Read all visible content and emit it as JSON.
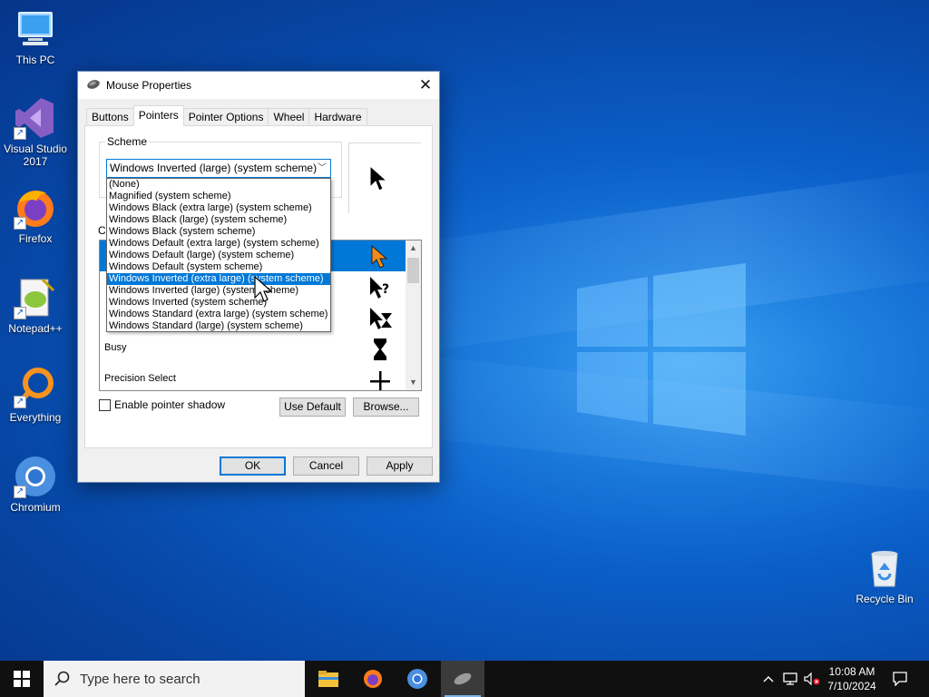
{
  "desktop": {
    "icons": [
      {
        "label": "This PC"
      },
      {
        "label": "Visual Studio 2017"
      },
      {
        "label": "Firefox"
      },
      {
        "label": "Notepad++"
      },
      {
        "label": "Everything"
      },
      {
        "label": "Chromium"
      },
      {
        "label": "Recycle Bin"
      }
    ]
  },
  "dialog": {
    "title": "Mouse Properties",
    "close_glyph": "✕",
    "tabs": [
      {
        "label": "Buttons"
      },
      {
        "label": "Pointers"
      },
      {
        "label": "Pointer Options"
      },
      {
        "label": "Wheel"
      },
      {
        "label": "Hardware"
      }
    ],
    "active_tab": "Pointers",
    "scheme": {
      "legend": "Scheme",
      "selected": "Windows Inverted (large) (system scheme)",
      "options": [
        "(None)",
        "Magnified (system scheme)",
        "Windows Black (extra large) (system scheme)",
        "Windows Black (large) (system scheme)",
        "Windows Black (system scheme)",
        "Windows Default (extra large) (system scheme)",
        "Windows Default (large) (system scheme)",
        "Windows Default (system scheme)",
        "Windows Inverted (extra large) (system scheme)",
        "Windows Inverted (large) (system scheme)",
        "Windows Inverted (system scheme)",
        "Windows Standard (extra large) (system scheme)",
        "Windows Standard (large) (system scheme)"
      ],
      "highlighted_option": "Windows Inverted (extra large) (system scheme)"
    },
    "customize_label": "C",
    "pointer_list": [
      {
        "label": "",
        "icon": "arrow-orange-icon"
      },
      {
        "label": "",
        "icon": "help-select-icon"
      },
      {
        "label": "",
        "icon": "working-in-background-icon"
      },
      {
        "label": "Busy",
        "icon": "hourglass-icon"
      },
      {
        "label": "Precision Select",
        "icon": "crosshair-icon"
      }
    ],
    "scroll_up": "▲",
    "scroll_down": "▼",
    "enable_shadow_label": "Enable pointer shadow",
    "use_default_label": "Use Default",
    "browse_label": "Browse...",
    "ok_label": "OK",
    "cancel_label": "Cancel",
    "apply_label": "Apply"
  },
  "taskbar": {
    "search_placeholder": "Type here to search",
    "time": "10:08 AM",
    "date": "7/10/2024"
  },
  "colors": {
    "accent": "#0078d7",
    "taskbar": "#101010"
  }
}
